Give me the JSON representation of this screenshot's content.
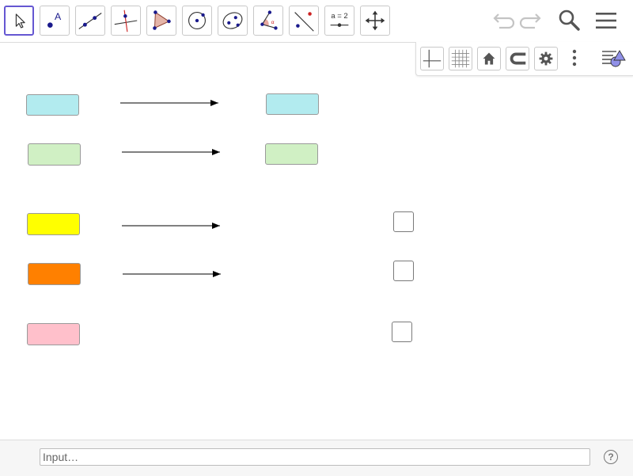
{
  "toolbar": {
    "tools": [
      {
        "name": "move-tool",
        "icon": "cursor-arrow-icon",
        "active": true
      },
      {
        "name": "point-tool",
        "icon": "point-icon",
        "label": "A"
      },
      {
        "name": "line-tool",
        "icon": "line-through-points-icon"
      },
      {
        "name": "perpendicular-line-tool",
        "icon": "perpendicular-line-icon"
      },
      {
        "name": "polygon-tool",
        "icon": "polygon-icon"
      },
      {
        "name": "circle-tool",
        "icon": "circle-center-point-icon"
      },
      {
        "name": "conic-tool",
        "icon": "ellipse-icon"
      },
      {
        "name": "angle-tool",
        "icon": "angle-icon"
      },
      {
        "name": "reflect-tool",
        "icon": "reflect-about-line-icon"
      },
      {
        "name": "slider-tool",
        "icon": "slider-icon",
        "label": "a = 2"
      },
      {
        "name": "move-graphics-tool",
        "icon": "move-arrows-icon"
      }
    ],
    "right": [
      "undo-icon",
      "redo-icon",
      "search-icon",
      "menu-icon"
    ]
  },
  "stylebar": [
    "axes-icon",
    "grid-icon",
    "home-icon",
    "snap-magnet-icon",
    "settings-gear-icon",
    "more-dots-icon",
    "toggle-style-bar-icon"
  ],
  "graphics": {
    "left_boxes": [
      {
        "name": "cyan-box",
        "color": "#b2ebef"
      },
      {
        "name": "green-box",
        "color": "#d0f0c4"
      },
      {
        "name": "yellow-box",
        "color": "#ffff00"
      },
      {
        "name": "orange-box",
        "color": "#ff8000"
      },
      {
        "name": "pink-box",
        "color": "#ffc0cb"
      }
    ],
    "right_boxes": [
      {
        "name": "cyan-target-box",
        "color": "#b2ebef"
      },
      {
        "name": "green-target-box",
        "color": "#d0f0c4"
      }
    ],
    "checkbox_count": 3,
    "arrow_color": "#000000"
  },
  "input_bar": {
    "placeholder": "Input…"
  },
  "help": {
    "label": "?"
  }
}
